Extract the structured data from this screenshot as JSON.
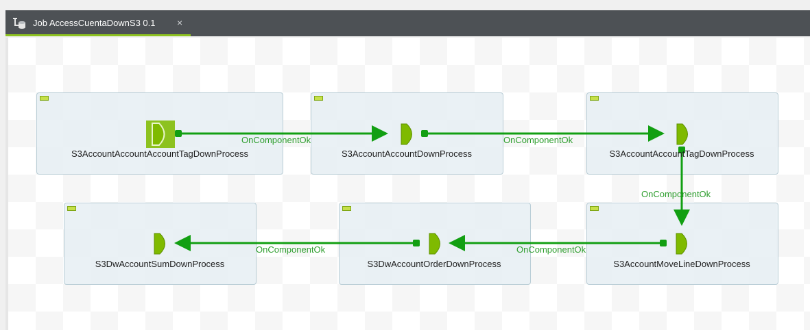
{
  "tab": {
    "title": "Job AccessCuentaDownS3 0.1",
    "close": "×",
    "icon": "job-icon"
  },
  "colors": {
    "tab_background": "#4d5155",
    "tab_active_underline": "#8dc21f",
    "component_green": "#7fba00",
    "link_green": "#129f12",
    "subjob_background": "#e8f0f4"
  },
  "components": [
    {
      "id": "n1",
      "label": "S3AccountAccountAccountTagDownProcess",
      "start": true
    },
    {
      "id": "n2",
      "label": "S3AccountAccountDownProcess"
    },
    {
      "id": "n3",
      "label": "S3AccountAccountTagDownProcess"
    },
    {
      "id": "n4",
      "label": "S3AccountMoveLineDownProcess"
    },
    {
      "id": "n5",
      "label": "S3DwAccountOrderDownProcess"
    },
    {
      "id": "n6",
      "label": "S3DwAccountSumDownProcess"
    }
  ],
  "connections": [
    {
      "from": "n1",
      "to": "n2",
      "label": "OnComponentOk"
    },
    {
      "from": "n2",
      "to": "n3",
      "label": "OnComponentOk"
    },
    {
      "from": "n3",
      "to": "n4",
      "label": "OnComponentOk"
    },
    {
      "from": "n4",
      "to": "n5",
      "label": "OnComponentOk"
    },
    {
      "from": "n5",
      "to": "n6",
      "label": "OnComponentOk"
    }
  ]
}
